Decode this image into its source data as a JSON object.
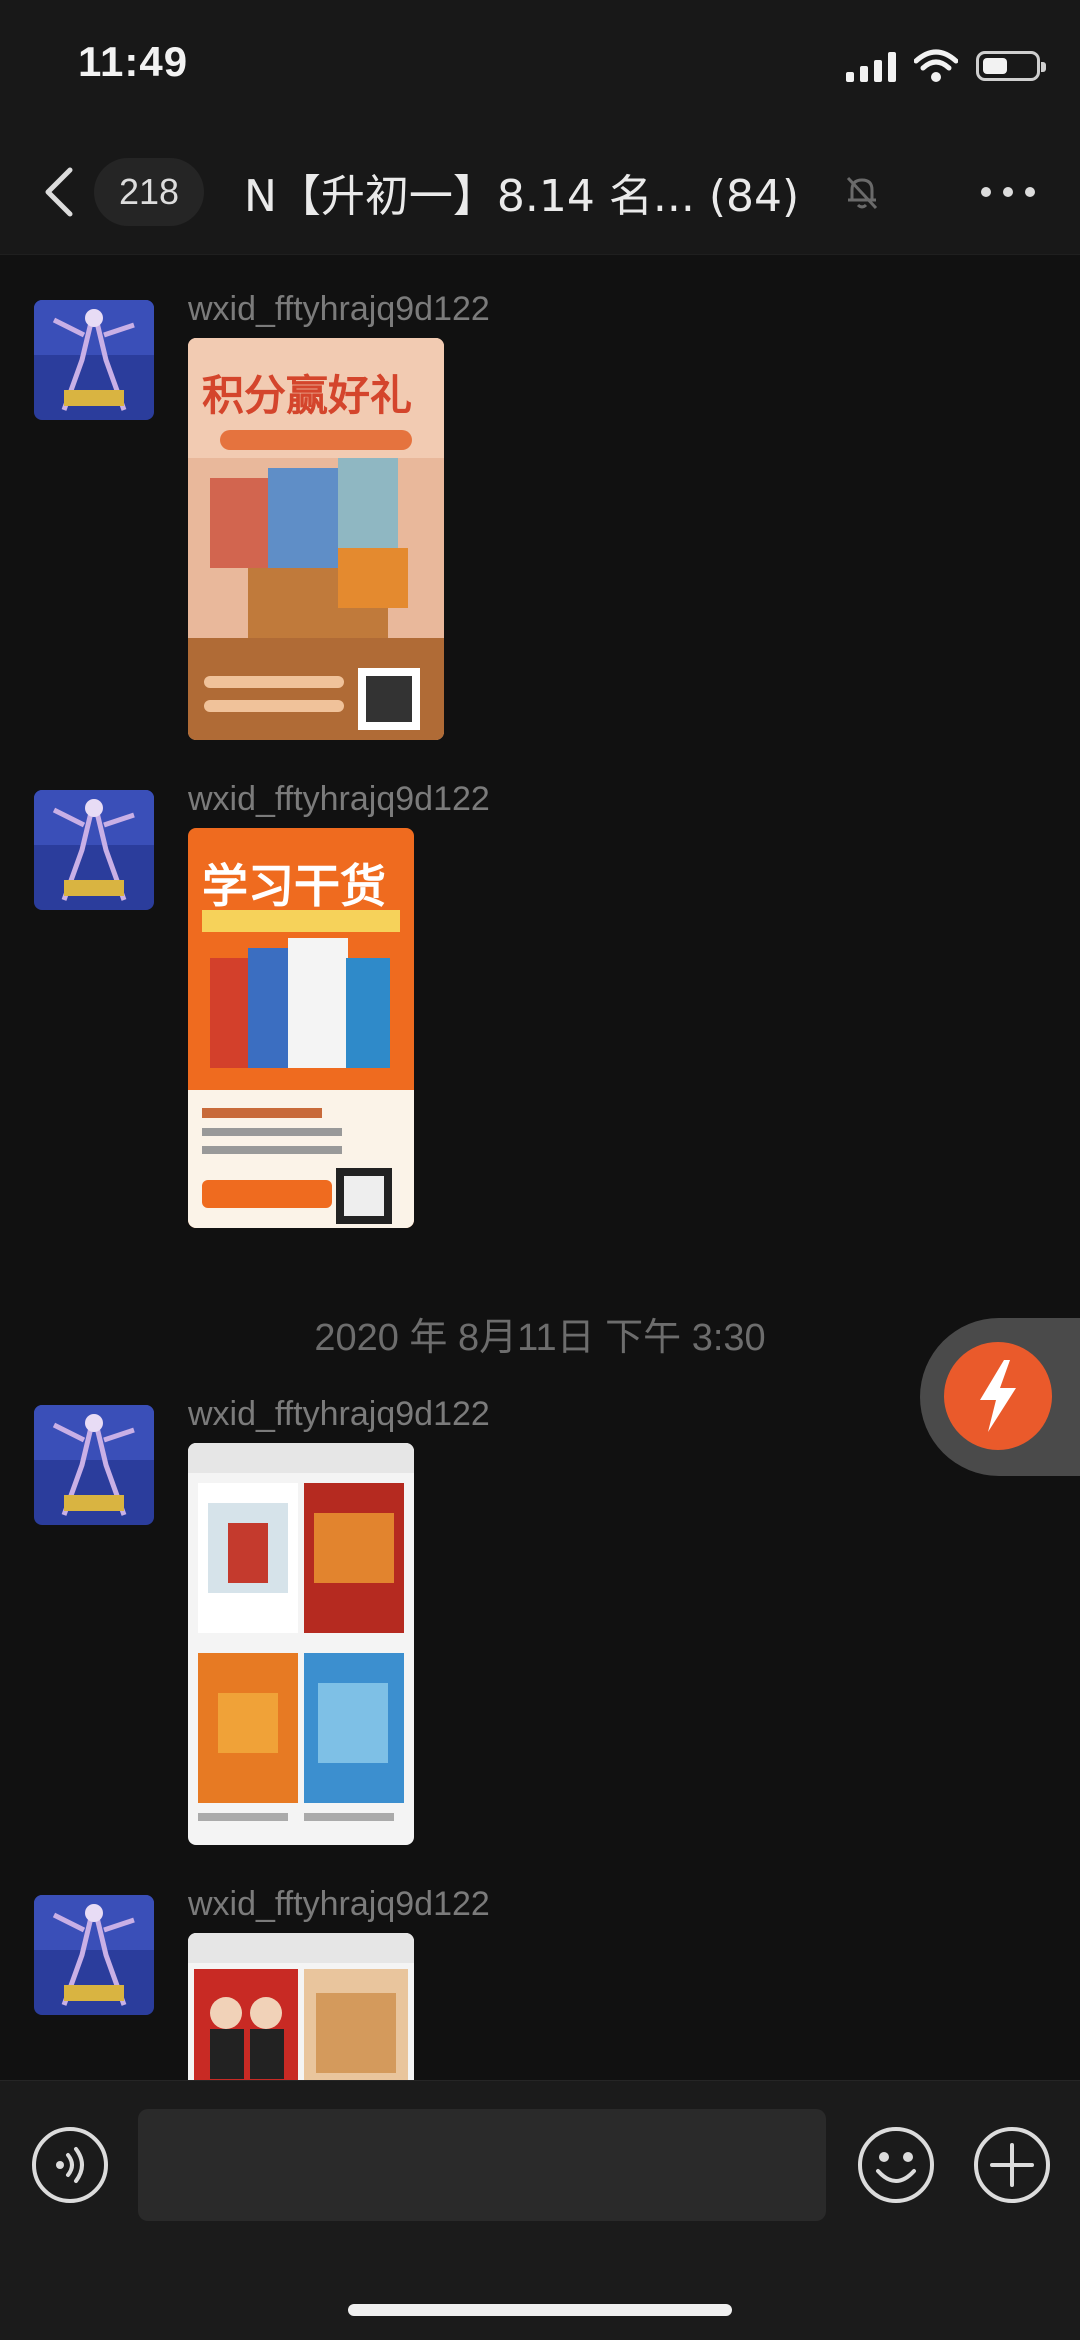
{
  "status_bar": {
    "time": "11:49"
  },
  "nav": {
    "unread_count": "218",
    "title": "N【升初一】8.14 名... (84)"
  },
  "messages": [
    {
      "sender": "wxid_fftyhrajq9d122",
      "image_title": "积分赢好礼"
    },
    {
      "sender": "wxid_fftyhrajq9d122",
      "image_title": "学习干货"
    },
    {
      "sender": "wxid_fftyhrajq9d122"
    },
    {
      "sender": "wxid_fftyhrajq9d122"
    }
  ],
  "timestamp": "2020 年 8月11日 下午 3:30",
  "input": {
    "placeholder": ""
  },
  "colors": {
    "accent": "#ea5a2b",
    "background": "#111111"
  }
}
